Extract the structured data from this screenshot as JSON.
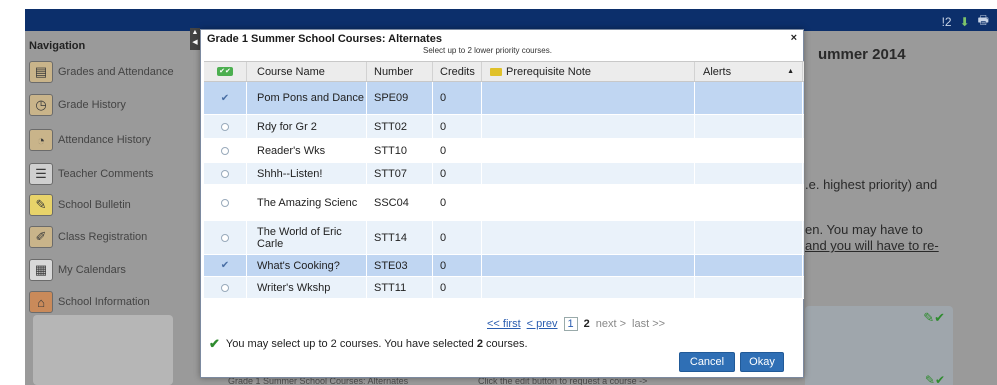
{
  "topbar": {
    "alert_count": "!2",
    "icons": [
      "alert-icon",
      "download-icon",
      "print-icon"
    ]
  },
  "sidebar": {
    "title": "Navigation",
    "items": [
      {
        "label": "Grades and Attendance",
        "icon": "grades-icon"
      },
      {
        "label": "Grade History",
        "icon": "history-icon"
      },
      {
        "label": "Attendance History",
        "icon": "attendance-icon"
      },
      {
        "label": "Teacher Comments",
        "icon": "comments-icon"
      },
      {
        "label": "School Bulletin",
        "icon": "bulletin-icon"
      },
      {
        "label": "Class Registration",
        "icon": "registration-icon"
      },
      {
        "label": "My Calendars",
        "icon": "calendar-icon"
      },
      {
        "label": "School Information",
        "icon": "school-icon"
      }
    ]
  },
  "background": {
    "heading": "ummer 2014",
    "line1": ".e. highest priority) and",
    "line2": "en. You may have to",
    "line3": "and you will have to re-",
    "bottom_left": "Grade 1 Summer School Courses: Alternates",
    "bottom_right": "Click the edit button to request a course ->"
  },
  "dialog": {
    "title": "Grade 1 Summer School Courses: Alternates",
    "subtitle": "Select up to 2 lower priority courses.",
    "close": "×",
    "columns": {
      "course_name": "Course Name",
      "number": "Number",
      "credits": "Credits",
      "prereq": "Prerequisite Note",
      "alerts": "Alerts"
    },
    "rows": [
      {
        "name": "Pom Pons and Dance",
        "number": "SPE09",
        "credits": "0",
        "selected": true
      },
      {
        "name": "Rdy for Gr 2",
        "number": "STT02",
        "credits": "0",
        "selected": false
      },
      {
        "name": "Reader's Wks",
        "number": "STT10",
        "credits": "0",
        "selected": false
      },
      {
        "name": "Shhh--Listen!",
        "number": "STT07",
        "credits": "0",
        "selected": false
      },
      {
        "name": "The Amazing Scienc",
        "number": "SSC04",
        "credits": "0",
        "selected": false
      },
      {
        "name": "The World of Eric Carle",
        "number": "STT14",
        "credits": "0",
        "selected": false
      },
      {
        "name": "What's Cooking?",
        "number": "STE03",
        "credits": "0",
        "selected": true
      },
      {
        "name": "Writer's Wkshp",
        "number": "STT11",
        "credits": "0",
        "selected": false
      }
    ],
    "pager": {
      "first": "<< first",
      "prev": "< prev",
      "page1": "1",
      "page2": "2",
      "next": "next >",
      "last": "last >>"
    },
    "message_pre": "You may select up to 2 courses. You have selected ",
    "message_count": "2",
    "message_post": " courses.",
    "cancel_label": "Cancel",
    "okay_label": "Okay"
  },
  "colors": {
    "topbar": "#0c2f6b",
    "selected_row": "#c0d6f2",
    "button": "#2f6fb5",
    "check_green": "#2e8b2e"
  }
}
